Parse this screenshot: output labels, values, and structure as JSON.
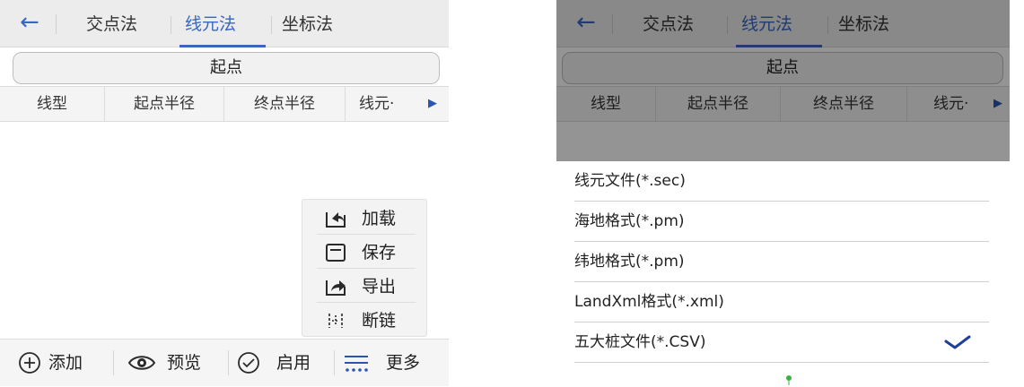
{
  "screen_left": {
    "tabs": {
      "back": "←",
      "items": [
        {
          "label": "交点法",
          "active": false
        },
        {
          "label": "线元法",
          "active": true
        },
        {
          "label": "坐标法",
          "active": false
        }
      ]
    },
    "start_label": "起点",
    "columns": [
      "线型",
      "起点半径",
      "终点半径",
      "线元·"
    ],
    "more_columns_arrow": "▶",
    "popup_menu": [
      {
        "label": "加载",
        "icon": "load-icon"
      },
      {
        "label": "保存",
        "icon": "save-icon"
      },
      {
        "label": "导出",
        "icon": "export-icon"
      },
      {
        "label": "断链",
        "icon": "chain-break-icon"
      }
    ],
    "toolbar": [
      {
        "label": "添加",
        "icon": "add-icon"
      },
      {
        "label": "预览",
        "icon": "eye-icon"
      },
      {
        "label": "启用",
        "icon": "check-circle-icon"
      },
      {
        "label": "更多",
        "icon": "more-menu-icon"
      }
    ]
  },
  "screen_right": {
    "tabs": {
      "back": "←",
      "items": [
        {
          "label": "交点法",
          "active": false
        },
        {
          "label": "线元法",
          "active": true
        },
        {
          "label": "坐标法",
          "active": false
        }
      ]
    },
    "start_label": "起点",
    "columns": [
      "线型",
      "起点半径",
      "终点半径",
      "线元·"
    ],
    "more_columns_arrow": "▶",
    "file_options": [
      {
        "label": "线元文件(*.sec)",
        "selected": false
      },
      {
        "label": "海地格式(*.pm)",
        "selected": false
      },
      {
        "label": "纬地格式(*.pm)",
        "selected": false
      },
      {
        "label": "LandXml格式(*.xml)",
        "selected": false
      },
      {
        "label": "五大桩文件(*.CSV)",
        "selected": true
      }
    ]
  },
  "colors": {
    "accent": "#3a66c0",
    "check": "#1e3f9a"
  }
}
